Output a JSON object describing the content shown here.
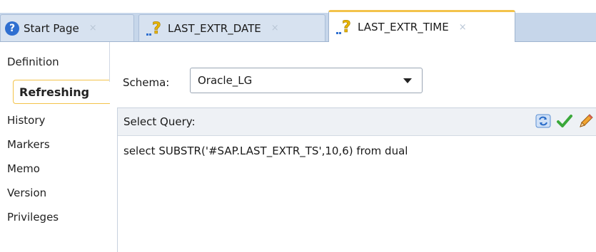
{
  "tabs": [
    {
      "label": "Start Page",
      "icon": "help-icon",
      "active": false
    },
    {
      "label": "LAST_EXTR_DATE",
      "icon": "question-mark-icon",
      "active": false
    },
    {
      "label": "LAST_EXTR_TIME",
      "icon": "question-mark-icon",
      "active": true
    }
  ],
  "tab_close_glyph": "×",
  "sidebar": {
    "items": [
      {
        "label": "Definition"
      },
      {
        "label": "Refreshing",
        "selected": true
      },
      {
        "label": "History"
      },
      {
        "label": "Markers"
      },
      {
        "label": "Memo"
      },
      {
        "label": "Version"
      },
      {
        "label": "Privileges"
      }
    ]
  },
  "schema": {
    "label": "Schema:",
    "value": "Oracle_LG"
  },
  "query": {
    "label": "Select Query:",
    "text": "select SUBSTR('#SAP.LAST_EXTR_TS',10,6) from dual",
    "tools": [
      "refresh-icon",
      "validate-check-icon",
      "edit-pencil-icon"
    ]
  },
  "colors": {
    "accent": "#f3c34a",
    "tab_strip": "#c6d6ea",
    "help_blue": "#2f6fd0",
    "check_green": "#3aa83a"
  }
}
